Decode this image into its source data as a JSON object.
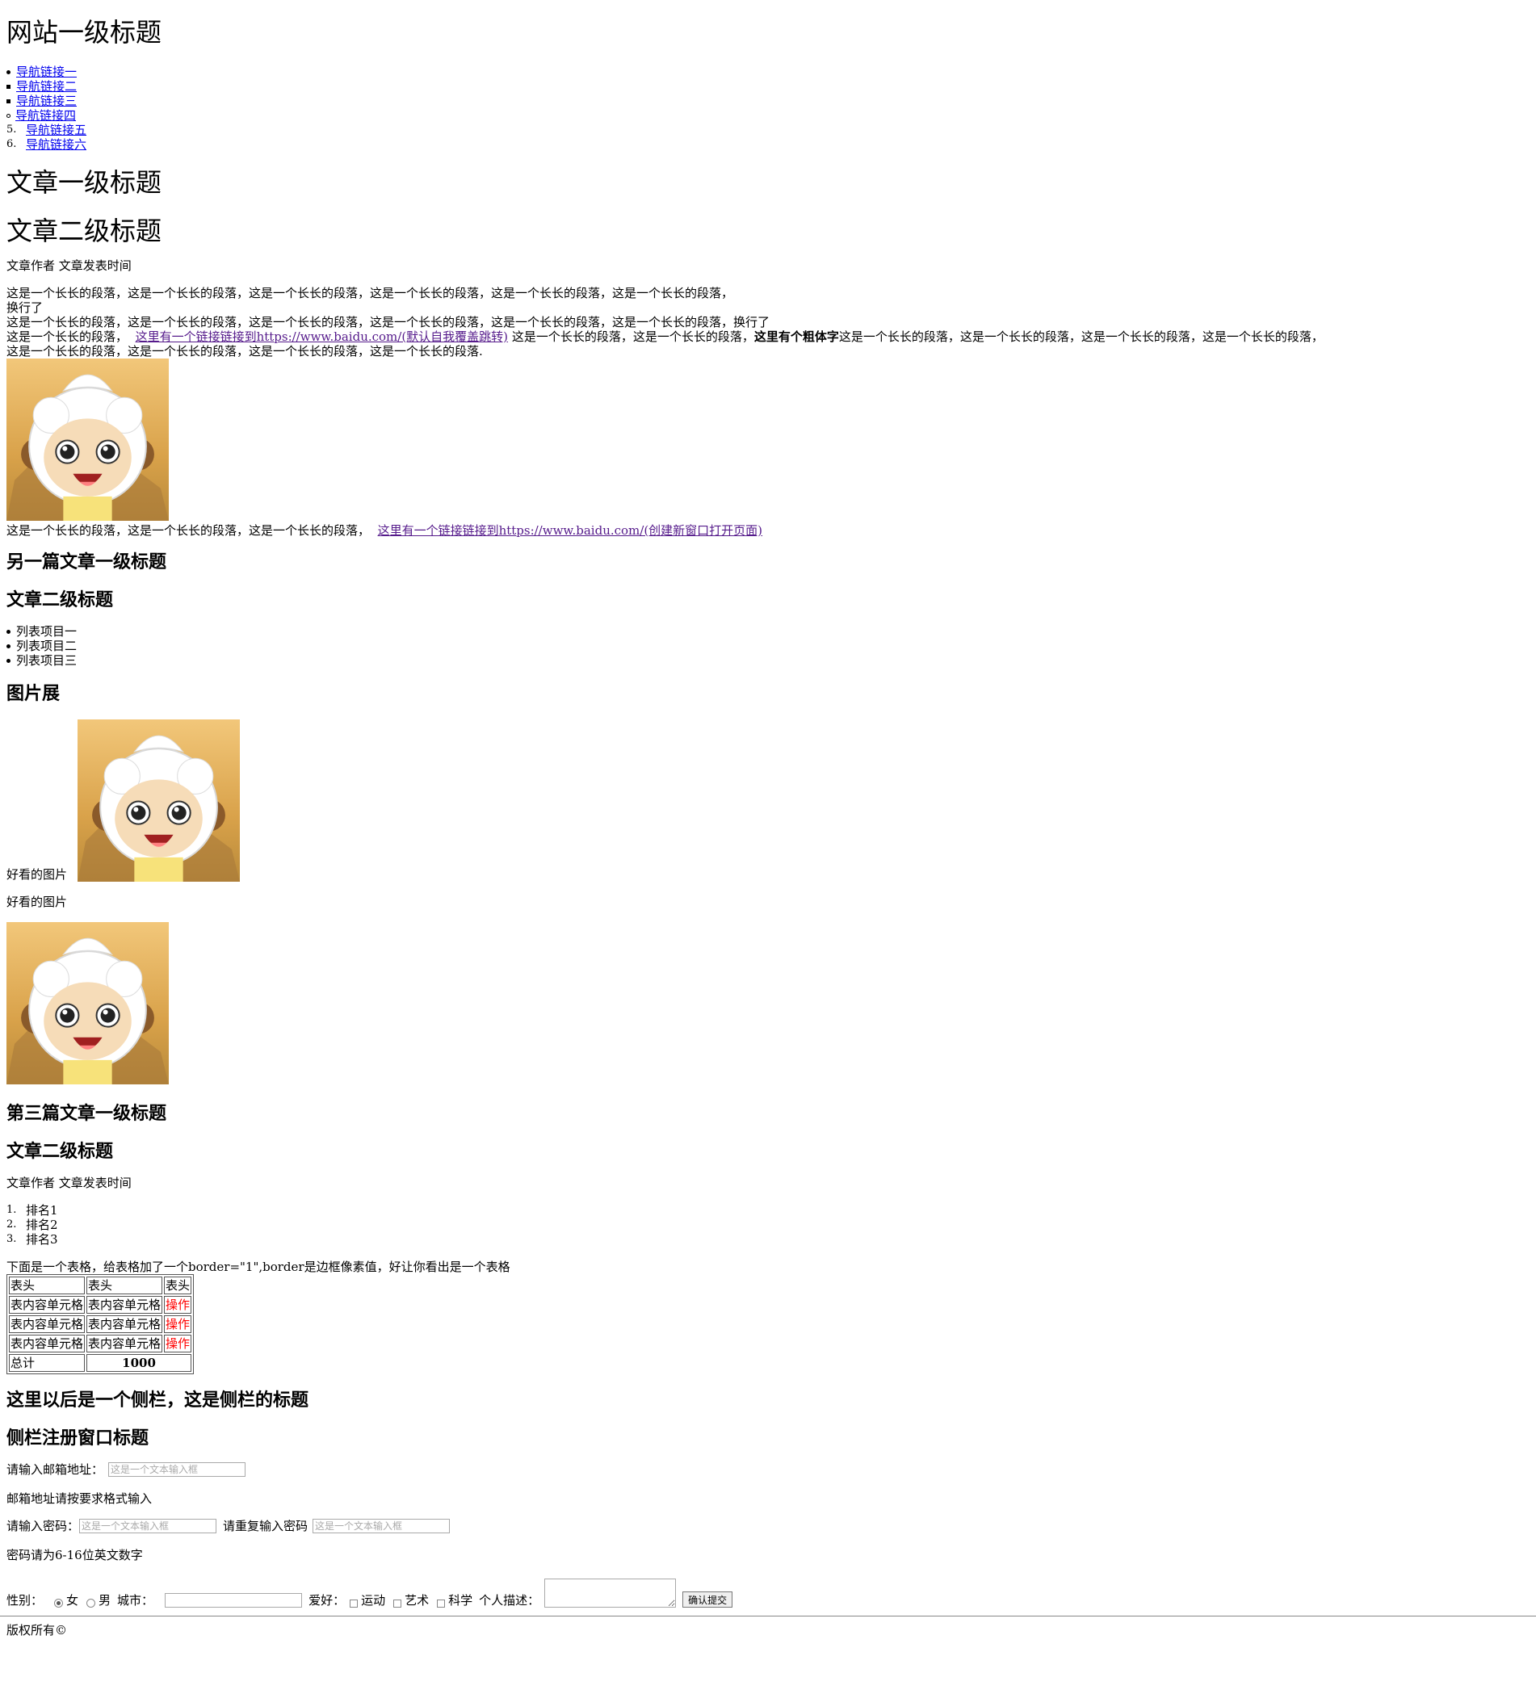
{
  "site_title": "网站一级标题",
  "nav": {
    "items": [
      {
        "label": "导航链接一",
        "marker": "disc"
      },
      {
        "label": "导航链接二",
        "marker": "square"
      },
      {
        "label": "导航链接三",
        "marker": "square"
      },
      {
        "label": "导航链接四",
        "marker": "circle"
      },
      {
        "label": "导航链接五",
        "marker": "5."
      },
      {
        "label": "导航链接六",
        "marker": "6."
      }
    ]
  },
  "article1": {
    "h1": "文章一级标题",
    "h2": "文章二级标题",
    "meta": "文章作者 文章发表时间",
    "p_line1": "这是一个长长的段落，这是一个长长的段落，这是一个长长的段落，这是一个长长的段落，这是一个长长的段落，这是一个长长的段落，",
    "p_line2": "换行了",
    "p_line3": "这是一个长长的段落，这是一个长长的段落，这是一个长长的段落，这是一个长长的段落，这是一个长长的段落，这是一个长长的段落，换行了",
    "p_line4_start": "这是一个长长的段落，",
    "p_line4_link": "这里有一个链接链接到https://www.baidu.com/(默认自我覆盖跳转)",
    "p_line4_mid": "这是一个长长的段落，这是一个长长的段落，",
    "p_line4_bold": "这里有个粗体字",
    "p_line4_end": "这是一个长长的段落，这是一个长长的段落，这是一个长长的段落，这是一个长长的段落，",
    "p_line5": "这是一个长长的段落，这是一个长长的段落，这是一个长长的段落，这是一个长长的段落.",
    "after_image_text": "这是一个长长的段落，这是一个长长的段落，这是一个长长的段落，",
    "after_image_link": "这里有一个链接链接到https://www.baidu.com/(创建新窗口打开页面)"
  },
  "article2": {
    "h1": "另一篇文章一级标题",
    "h2": "文章二级标题",
    "list": [
      "列表项目一",
      "列表项目二",
      "列表项目三"
    ],
    "gallery_title": "图片展",
    "caption1": "好看的图片",
    "caption2": "好看的图片"
  },
  "article3": {
    "h1": "第三篇文章一级标题",
    "h2": "文章二级标题",
    "meta": "文章作者 文章发表时间",
    "ranks": [
      "排名1",
      "排名2",
      "排名3"
    ],
    "table_intro": "下面是一个表格，给表格加了一个border=\"1\",border是边框像素值，好让你看出是一个表格",
    "table": {
      "header": [
        "表头",
        "表头",
        "表头"
      ],
      "rows": [
        [
          "表内容单元格",
          "表内容单元格",
          "操作"
        ],
        [
          "表内容单元格",
          "表内容单元格",
          "操作"
        ],
        [
          "表内容单元格",
          "表内容单元格",
          "操作"
        ]
      ],
      "total_label": "总计",
      "total_value": "1000"
    }
  },
  "sidebar": {
    "title": "这里以后是一个侧栏，这是侧栏的标题",
    "form_title": "侧栏注册窗口标题",
    "email_label": "请输入邮箱地址：",
    "email_placeholder": "这是一个文本输入框",
    "email_hint": "邮箱地址请按要求格式输入",
    "pwd_label": "请输入密码：",
    "pwd_placeholder": "这是一个文本输入框",
    "pwd2_label": "请重复输入密码",
    "pwd2_placeholder": "这是一个文本输入框",
    "pwd_hint": "密码请为6-16位英文数字",
    "gender_label": "性别：",
    "gender_female": "女",
    "gender_male": "男",
    "city_label": "城市：",
    "hobby_label": "爱好：",
    "hobby_sport": "运动",
    "hobby_art": "艺术",
    "hobby_science": "科学",
    "desc_label": "个人描述：",
    "submit_label": "确认提交"
  },
  "footer": {
    "copyright": "版权所有©"
  },
  "colors": {
    "link": "#0000ee",
    "visited": "#551a8b",
    "operation": "#ff0000"
  }
}
